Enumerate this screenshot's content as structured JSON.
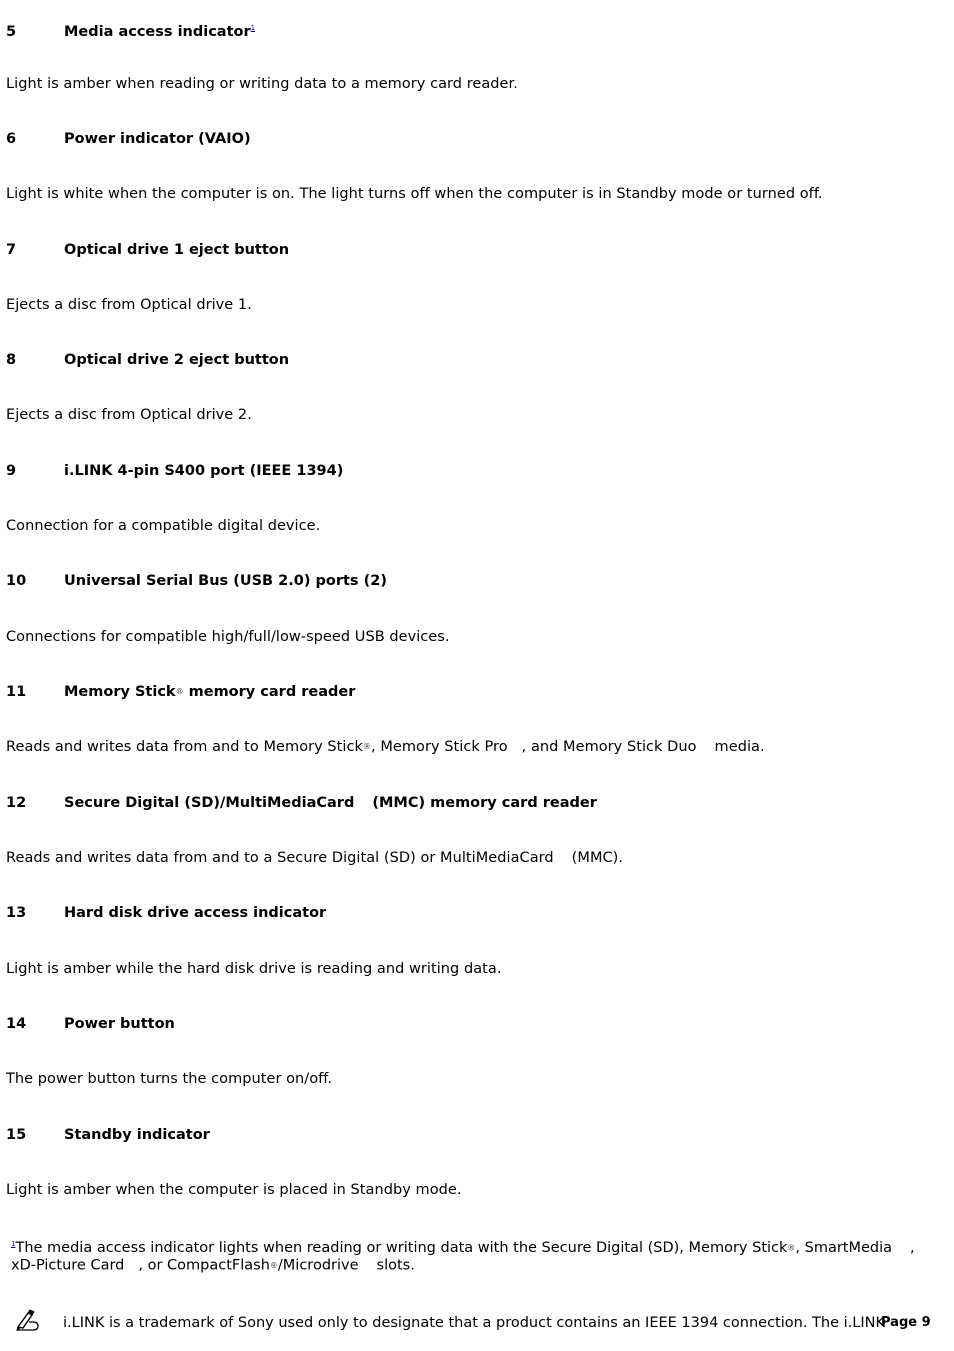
{
  "items": [
    {
      "num": "5",
      "title": "Media access indicator",
      "footnote_ref": "1",
      "desc": "Light is amber when reading or writing data to a memory card reader."
    },
    {
      "num": "6",
      "title": "Power indicator (VAIO)",
      "desc": "Light is white when the computer is on. The light turns off when the computer is in Standby mode or turned off."
    },
    {
      "num": "7",
      "title": "Optical drive 1 eject button",
      "desc": "Ejects a disc from Optical drive 1."
    },
    {
      "num": "8",
      "title": "Optical drive 2 eject button",
      "desc": "Ejects a disc from Optical drive 2."
    },
    {
      "num": "9",
      "title": "i.LINK 4-pin S400 port (IEEE 1394)",
      "desc": "Connection for a compatible digital device."
    },
    {
      "num": "10",
      "title": "Universal Serial Bus (USB 2.0) ports (2)",
      "desc": "Connections for compatible high/full/low-speed USB devices."
    },
    {
      "num": "11",
      "title_part1": "Memory Stick",
      "reg": "®",
      "title_part2": " memory card reader",
      "desc_part1": "Reads and writes data from and to Memory Stick",
      "desc_reg": "®",
      "desc_part2": ", Memory Stick Pro",
      "desc_part3": ", and Memory Stick Duo",
      "desc_part4": "media."
    },
    {
      "num": "12",
      "title_part1": "Secure Digital (SD)/MultiMediaCard",
      "title_part2": "(MMC) memory card reader",
      "desc_part1": "Reads and writes data from and to a Secure Digital (SD) or MultiMediaCard",
      "desc_part2": "(MMC)."
    },
    {
      "num": "13",
      "title": "Hard disk drive access indicator",
      "desc": "Light is amber while the hard disk drive is reading and writing data."
    },
    {
      "num": "14",
      "title": "Power button",
      "desc": "The power button turns the computer on/off."
    },
    {
      "num": "15",
      "title": "Standby indicator",
      "desc": "Light is amber when the computer is placed in Standby mode."
    }
  ],
  "footnote": {
    "mark": "1",
    "line1_part1": "The media access indicator lights when reading or writing data with the Secure Digital (SD), Memory Stick",
    "line1_reg": "®",
    "line1_part2": ", SmartMedia",
    "line1_part3": ",",
    "line2_part1": "xD-Picture Card",
    "line2_part2": ", or CompactFlash",
    "line2_reg": "®",
    "line2_part3": "/Microdrive",
    "line2_part4": "slots."
  },
  "note": {
    "icon": "note-pencil-icon",
    "text": "i.LINK is a trademark of Sony used only to designate that a product contains an IEEE 1394 connection. The i.LINK"
  },
  "page_label": "Page 9"
}
